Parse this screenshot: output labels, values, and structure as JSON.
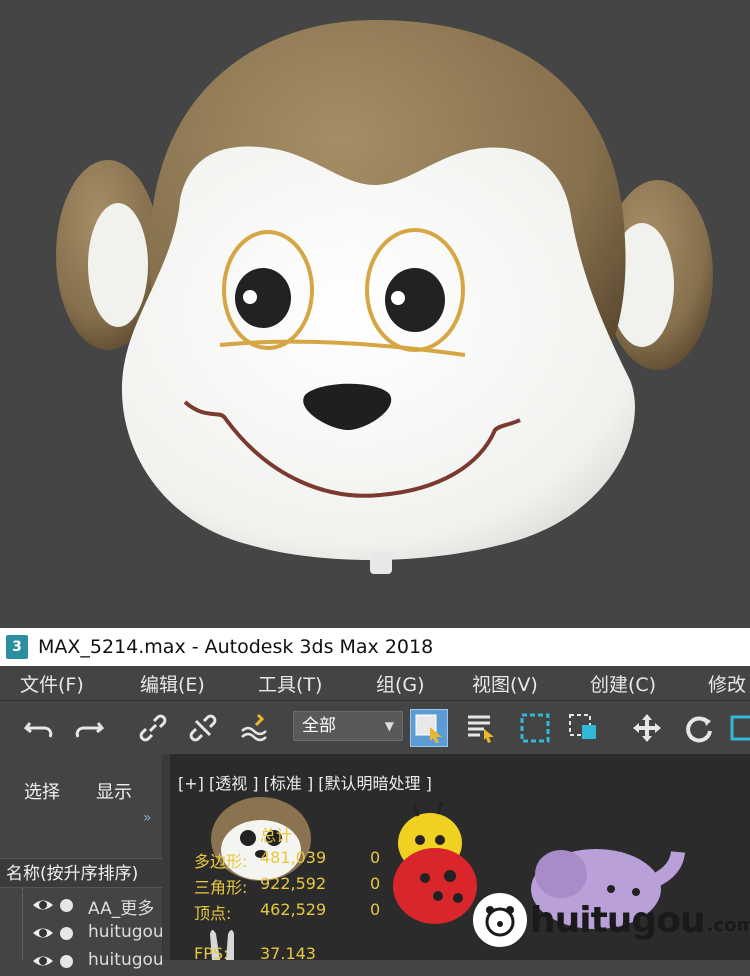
{
  "window": {
    "title": "MAX_5214.max - Autodesk 3ds Max 2018",
    "logo_text": "3"
  },
  "menu": [
    {
      "label": "文件(F)"
    },
    {
      "label": "编辑(E)"
    },
    {
      "label": "工具(T)"
    },
    {
      "label": "组(G)"
    },
    {
      "label": "视图(V)"
    },
    {
      "label": "创建(C)"
    },
    {
      "label": "修改"
    }
  ],
  "toolbar": {
    "selection_filter": "全部"
  },
  "panel": {
    "tabs": [
      {
        "label": "选择"
      },
      {
        "label": "显示"
      }
    ],
    "expander": "»",
    "list_header": "名称(按升序排序)",
    "rows": [
      {
        "name": "AA_更多"
      },
      {
        "name": "huitugou"
      },
      {
        "name": "huitugou"
      }
    ]
  },
  "viewport": {
    "label": "[+] [透视 ] [标准 ] [默认明暗处理 ]",
    "stats": {
      "total_label": "总计",
      "polys_label": "多边形:",
      "polys_value": "481,039",
      "polys_sel": "0",
      "tris_label": "三角形:",
      "tris_value": "922,592",
      "tris_sel": "0",
      "verts_label": "顶点:",
      "verts_value": "462,529",
      "verts_sel": "0",
      "fps_label": "FPS:",
      "fps_value": "37.143"
    }
  },
  "watermark": {
    "text": "huitugou",
    "suffix": ".com"
  },
  "colors": {
    "monkey_fur": "#8a7350",
    "face": "#f5f5f2",
    "eye_ring": "#d6a644",
    "stats_yellow": "#e8c840",
    "highlight_blue": "#5d9bd5"
  }
}
